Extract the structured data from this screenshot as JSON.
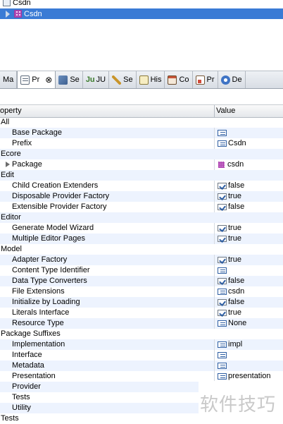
{
  "tree": {
    "items": [
      {
        "label": "Csdn",
        "icon": "resource-file-icon",
        "selected": false
      },
      {
        "label": "Csdn",
        "icon": "package-icon",
        "selected": true
      }
    ]
  },
  "tabs": [
    {
      "label": "Ma",
      "icon": "none",
      "active": false
    },
    {
      "label": "Pr",
      "icon": "properties-icon",
      "active": true,
      "close": "⊗"
    },
    {
      "label": "Se",
      "icon": "servers-icon",
      "active": false
    },
    {
      "label": "JU",
      "icon": "junit-icon",
      "icon_text": "Ju",
      "active": false
    },
    {
      "label": "Se",
      "icon": "search-icon",
      "active": false
    },
    {
      "label": "His",
      "icon": "history-icon",
      "active": false
    },
    {
      "label": "Co",
      "icon": "console-icon",
      "active": false
    },
    {
      "label": "Pr",
      "icon": "progress-icon",
      "active": false
    },
    {
      "label": "De",
      "icon": "debug-icon",
      "active": false
    }
  ],
  "properties": {
    "header": {
      "property": "operty",
      "value": "Value"
    },
    "rows": [
      {
        "type": "category",
        "key": "All"
      },
      {
        "type": "prop",
        "key": "Base Package",
        "value_icon": "text",
        "value": ""
      },
      {
        "type": "prop",
        "key": "Prefix",
        "value_icon": "text",
        "value": "Csdn"
      },
      {
        "type": "category",
        "key": "Ecore"
      },
      {
        "type": "expandable",
        "key": "Package",
        "value_icon": "pkg",
        "value": "csdn"
      },
      {
        "type": "category",
        "key": "Edit"
      },
      {
        "type": "prop",
        "key": "Child Creation Extenders",
        "value_icon": "bool",
        "value": "false"
      },
      {
        "type": "prop",
        "key": "Disposable Provider Factory",
        "value_icon": "bool",
        "value": "true"
      },
      {
        "type": "prop",
        "key": "Extensible Provider Factory",
        "value_icon": "bool",
        "value": "false"
      },
      {
        "type": "category",
        "key": "Editor"
      },
      {
        "type": "prop",
        "key": "Generate Model Wizard",
        "value_icon": "bool",
        "value": "true"
      },
      {
        "type": "prop",
        "key": "Multiple Editor Pages",
        "value_icon": "bool",
        "value": "true"
      },
      {
        "type": "category",
        "key": "Model"
      },
      {
        "type": "prop",
        "key": "Adapter Factory",
        "value_icon": "bool",
        "value": "true"
      },
      {
        "type": "prop",
        "key": "Content Type Identifier",
        "value_icon": "text",
        "value": ""
      },
      {
        "type": "prop",
        "key": "Data Type Converters",
        "value_icon": "bool",
        "value": "false"
      },
      {
        "type": "prop",
        "key": "File Extensions",
        "value_icon": "text",
        "value": "csdn"
      },
      {
        "type": "prop",
        "key": "Initialize by Loading",
        "value_icon": "bool",
        "value": "false"
      },
      {
        "type": "prop",
        "key": "Literals Interface",
        "value_icon": "bool",
        "value": "true"
      },
      {
        "type": "prop",
        "key": "Resource Type",
        "value_icon": "text",
        "value": "None"
      },
      {
        "type": "category",
        "key": "Package Suffixes"
      },
      {
        "type": "prop",
        "key": "Implementation",
        "value_icon": "text",
        "value": "impl"
      },
      {
        "type": "prop",
        "key": "Interface",
        "value_icon": "text",
        "value": ""
      },
      {
        "type": "prop",
        "key": "Metadata",
        "value_icon": "text",
        "value": ""
      },
      {
        "type": "prop",
        "key": "Presentation",
        "value_icon": "text",
        "value": "presentation"
      },
      {
        "type": "prop",
        "key": "Provider",
        "value_icon": "",
        "value": ""
      },
      {
        "type": "prop",
        "key": "Tests",
        "value_icon": "",
        "value": ""
      },
      {
        "type": "prop",
        "key": "Utility",
        "value_icon": "",
        "value": ""
      },
      {
        "type": "category",
        "key": "Tests"
      }
    ]
  },
  "watermark": "软件技巧"
}
